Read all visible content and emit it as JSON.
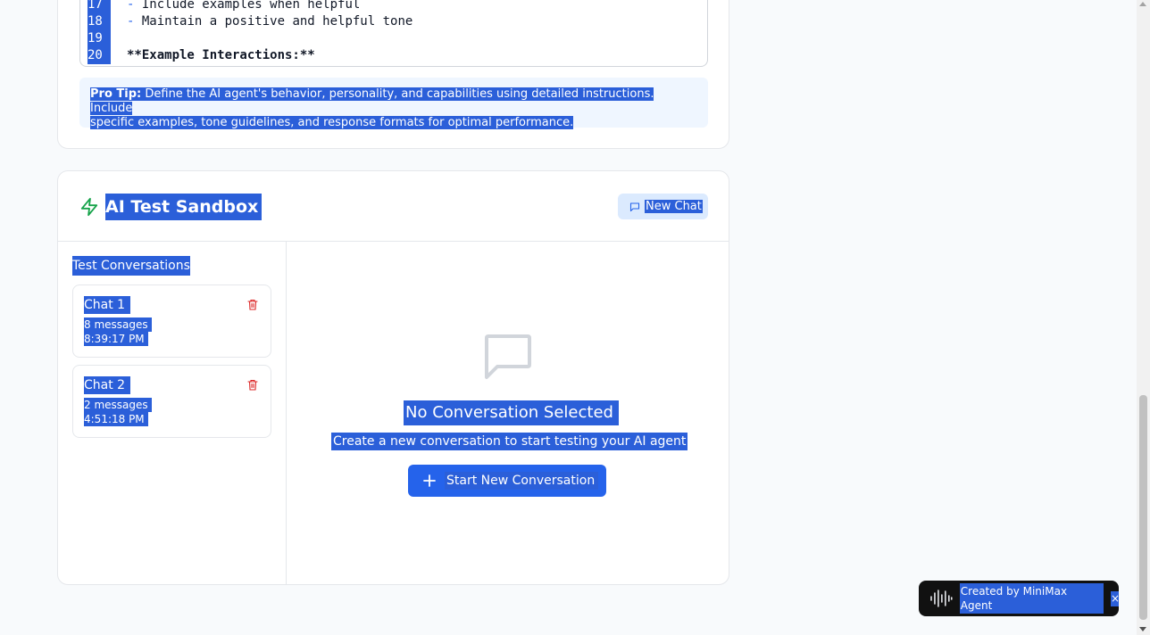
{
  "editor": {
    "lines": [
      {
        "number": "17",
        "prefix": "-",
        "text": " Include examples when helpful"
      },
      {
        "number": "18",
        "prefix": "-",
        "text": " Maintain a positive and helpful tone"
      },
      {
        "number": "19",
        "prefix": "",
        "text": ""
      },
      {
        "number": "20",
        "prefix": "",
        "text": "**Example Interactions:**"
      }
    ]
  },
  "tip": {
    "label": "Pro Tip:",
    "line1": " Define the AI agent's behavior, personality, and capabilities using detailed instructions. Include",
    "line2": "specific examples, tone guidelines, and response formats for optimal performance."
  },
  "sandbox": {
    "title": "AI Test Sandbox",
    "new_chat_label": "New Chat",
    "conversations_heading": "Test Conversations",
    "conversations": [
      {
        "title": "Chat 1",
        "messages": "8 messages",
        "time": "8:39:17 PM"
      },
      {
        "title": "Chat 2",
        "messages": "2 messages",
        "time": "4:51:18 PM"
      }
    ],
    "empty_title": "No Conversation Selected",
    "empty_subtitle": "Create a new conversation to start testing your AI agent",
    "start_button": "Start New Conversation"
  },
  "badge": {
    "text": "Created by MiniMax Agent",
    "close": "×"
  },
  "colors": {
    "selection": "#2b5fd9",
    "primary": "#2563eb",
    "accent_green": "#16a34a",
    "danger": "#dc2626"
  },
  "icons": [
    "lightning-icon",
    "message-square-icon",
    "trash-icon",
    "plus-icon",
    "waveform-icon"
  ]
}
